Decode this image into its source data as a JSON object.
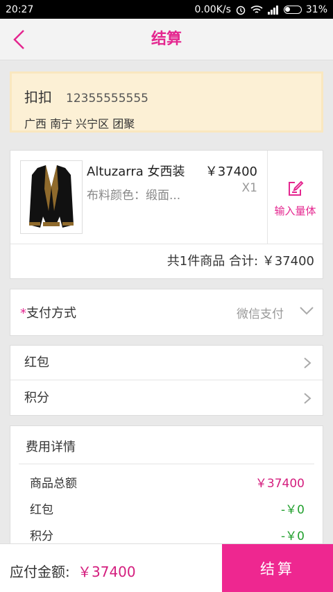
{
  "statusbar": {
    "time": "20:27",
    "net_speed": "0.00K/s",
    "battery": "31%"
  },
  "header": {
    "back_icon": "chevron-left-icon",
    "title": "结算"
  },
  "address": {
    "name": "扣扣",
    "phone": "12355555555",
    "region": "广西 南宁 兴宁区 团聚"
  },
  "order": {
    "product": {
      "name": "Altuzarra  女西装",
      "price": "￥37400",
      "spec": "布料颜色：缎面...",
      "qty": "X1",
      "image_icon": "blazer-image"
    },
    "measure": {
      "icon": "edit-icon",
      "label": "输入量体"
    },
    "summary": "共1件商品  合计: ￥37400"
  },
  "payment": {
    "required_mark": "*",
    "label": "支付方式",
    "value": "微信支付"
  },
  "perks": [
    {
      "label": "红包"
    },
    {
      "label": "积分"
    }
  ],
  "fees": {
    "title": "费用详情",
    "rows": [
      {
        "label": "商品总额",
        "value": "￥37400"
      },
      {
        "label": "红包",
        "value": "-￥0"
      },
      {
        "label": "积分",
        "value": "-￥0"
      }
    ]
  },
  "bottom": {
    "due_label": "应付金额:",
    "due_value": "￥37400",
    "checkout_label": "结算"
  },
  "colors": {
    "accent": "#e4268f",
    "button": "#ee2790",
    "price": "#d41e7e",
    "discount": "#22a02e",
    "address_bg": "#fcf0d5"
  }
}
